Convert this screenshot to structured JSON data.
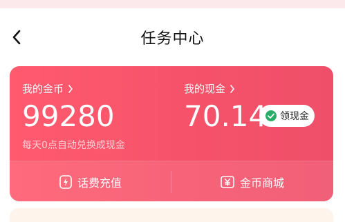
{
  "header": {
    "title": "任务中心"
  },
  "coins": {
    "label": "我的金币",
    "value": "99280",
    "note": "每天0点自动兑换成现金"
  },
  "cash": {
    "label": "我的现金",
    "value": "70.14",
    "claim_label": "领现金"
  },
  "actions": [
    {
      "label": "话费充值",
      "icon": "lightning-icon"
    },
    {
      "label": "金币商城",
      "icon": "yen-icon"
    }
  ],
  "colors": {
    "card_start": "#ff5a6e",
    "card_end": "#ef4f69",
    "wechat_green": "#2aae67"
  }
}
